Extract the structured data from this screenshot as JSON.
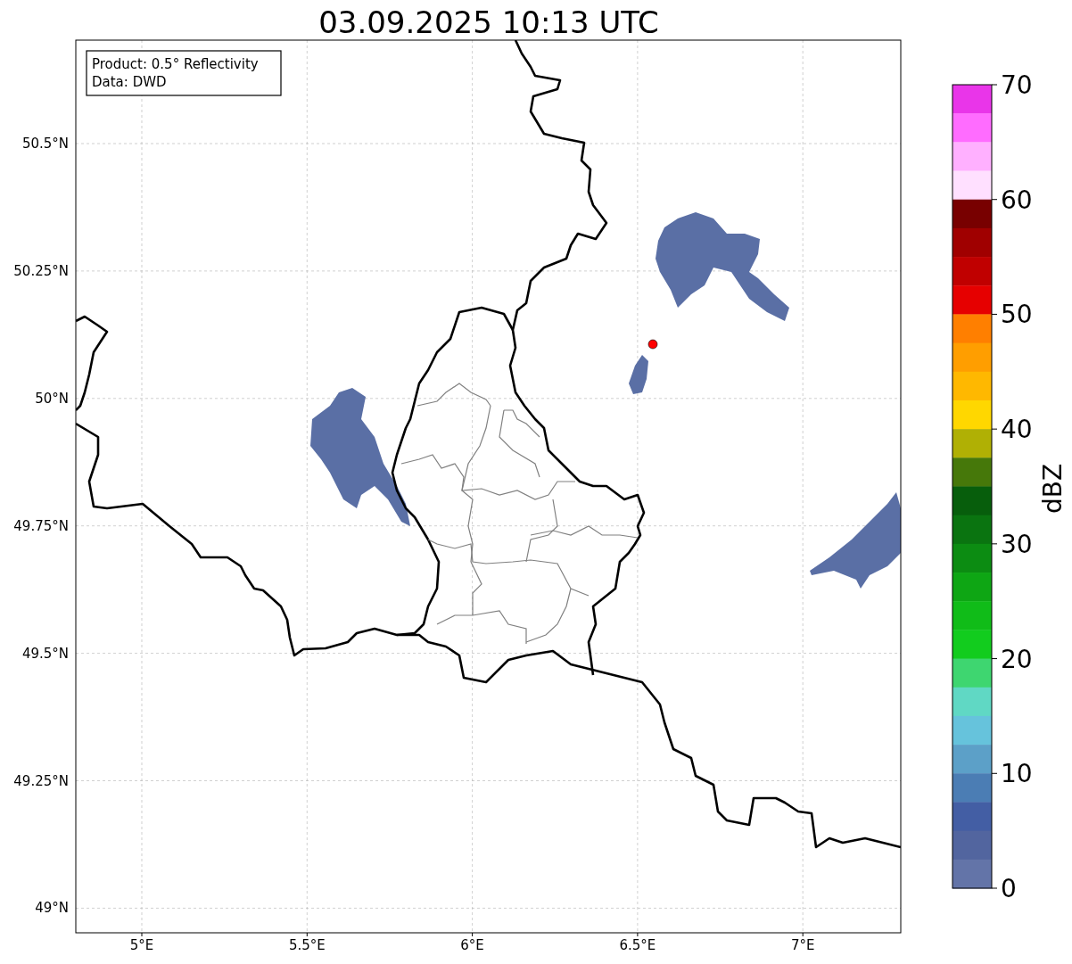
{
  "title": "03.09.2025 10:13 UTC",
  "info_box": [
    "Product: 0.5° Reflectivity",
    "Data: DWD"
  ],
  "x_ticks": [
    "5°E",
    "5.5°E",
    "6°E",
    "6.5°E",
    "7°E"
  ],
  "y_ticks": [
    "50.5°N",
    "50.25°N",
    "50°N",
    "49.75°N",
    "49.5°N",
    "49.25°N",
    "49°N"
  ],
  "colorbar": {
    "label": "dBZ",
    "ticks": [
      "70",
      "60",
      "50",
      "40",
      "30",
      "20",
      "10",
      "0"
    ],
    "bands": [
      {
        "color": "#e935e9"
      },
      {
        "color": "#ff6cff"
      },
      {
        "color": "#ffb0ff"
      },
      {
        "color": "#ffe0ff"
      },
      {
        "color": "#780000"
      },
      {
        "color": "#a00000"
      },
      {
        "color": "#c00000"
      },
      {
        "color": "#e60000"
      },
      {
        "color": "#ff7f00"
      },
      {
        "color": "#ff9e00"
      },
      {
        "color": "#ffb800"
      },
      {
        "color": "#ffd700"
      },
      {
        "color": "#b0b004"
      },
      {
        "color": "#46780a"
      },
      {
        "color": "#075e0c"
      },
      {
        "color": "#0a7410"
      },
      {
        "color": "#0c8c12"
      },
      {
        "color": "#0ea614"
      },
      {
        "color": "#10bc18"
      },
      {
        "color": "#12cc1e"
      },
      {
        "color": "#3ed670"
      },
      {
        "color": "#60d8c4"
      },
      {
        "color": "#66c3dc"
      },
      {
        "color": "#5ca0c8"
      },
      {
        "color": "#4b7db4"
      },
      {
        "color": "#435ea4"
      },
      {
        "color": "#52659f"
      },
      {
        "color": "#6374a8"
      }
    ]
  }
}
